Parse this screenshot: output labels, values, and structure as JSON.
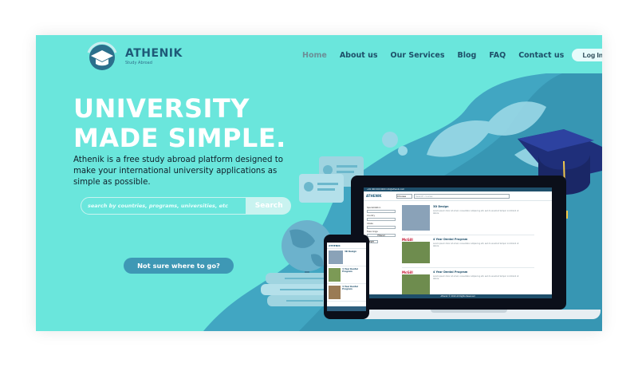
{
  "brand": {
    "name": "ATHENIK",
    "tagline": "Study Abroad"
  },
  "nav": {
    "items": [
      {
        "label": "Home",
        "active": true
      },
      {
        "label": "About us",
        "active": false
      },
      {
        "label": "Our Services",
        "active": false
      },
      {
        "label": "Blog",
        "active": false
      },
      {
        "label": "FAQ",
        "active": false
      },
      {
        "label": "Contact us",
        "active": false
      }
    ],
    "login_label": "Log In"
  },
  "hero": {
    "title_line1": "UNIVERSITY",
    "title_line2": "MADE SIMPLE.",
    "description": "Athenik is a free study abroad platform designed to make your international university applications as simple as possible.",
    "search_placeholder": "search by countries, programs, universities, etc",
    "search_button": "Search",
    "cta_label": "Not sure where to go?"
  },
  "laptop_screen": {
    "topbar": "+91 000 000 0000    info@athenik.com",
    "logo": "ATHENIK",
    "select_value": "Choose",
    "search_placeholder": "Search course",
    "filters": [
      "Specialization",
      "Country",
      "Intake",
      "Fees range"
    ],
    "filter_button": "Filtered",
    "reset_button": "RESET",
    "results": [
      {
        "title": "3D Design",
        "desc": "Lorem ipsum dolor sit amet, consectetur adipiscing elit, sed do eiusmod tempor incididunt ut labore."
      },
      {
        "title": "4 Year Dental Program",
        "desc": "Lorem ipsum dolor sit amet, consectetur adipiscing elit, sed do eiusmod tempor incididunt ut labore."
      },
      {
        "title": "4 Year Dental Program",
        "desc": "Lorem ipsum dolor sit amet, consectetur adipiscing elit, sed do eiusmod tempor incididunt ut labore."
      }
    ],
    "university_badge": "McGill",
    "footer": "Athenik © 2019 All Rights Reserved"
  },
  "phone_screen": {
    "logo": "ATHENIK",
    "results": [
      {
        "title": "3D Design"
      },
      {
        "title": "4 Year Dental Program"
      },
      {
        "title": "4 Year Dental Program"
      }
    ]
  },
  "colors": {
    "background": "#6ae6dc",
    "dark_blue": "#1e5a78",
    "mid_blue": "#3e98b5",
    "light_cyan": "#c9f3f0",
    "cap_navy": "#1f2f7a",
    "cap_tassel": "#f2c94c"
  }
}
